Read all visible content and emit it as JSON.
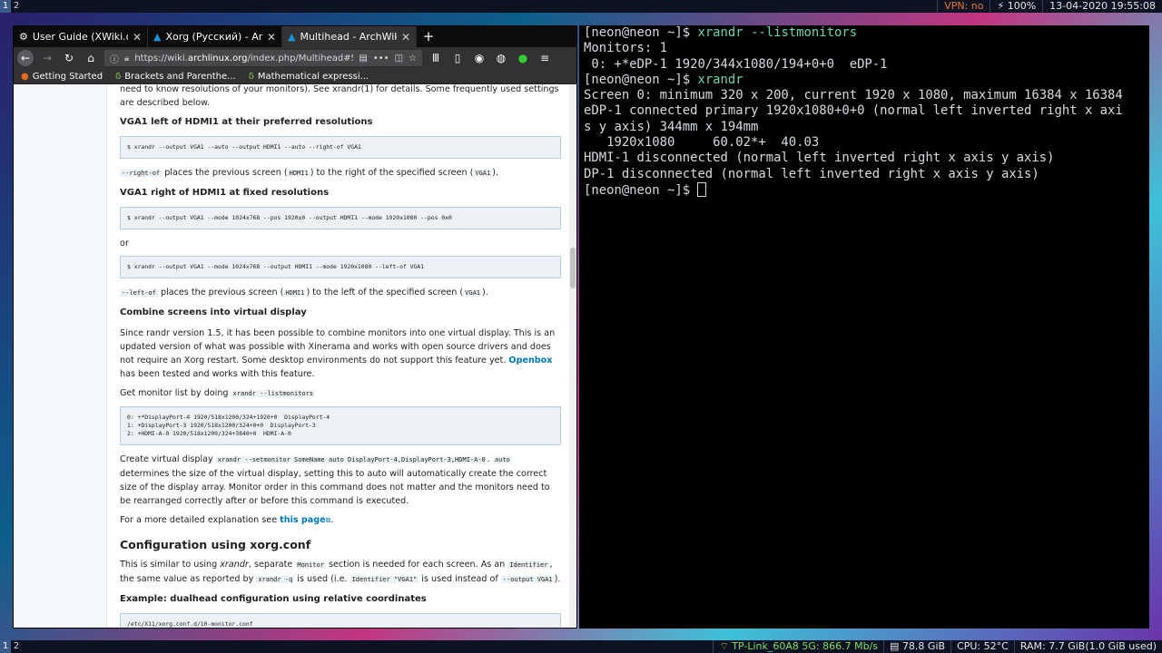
{
  "topbar": {
    "workspaces": [
      "1",
      "2"
    ],
    "vpn": "VPN: no",
    "battery": "100%",
    "battery_icon": "⚡",
    "datetime": "13-04-2020 19:55:08"
  },
  "bottombar": {
    "workspaces": [
      "1",
      "2"
    ],
    "wifi": "TP-Link_60A8 5G: 866.7 Mb/s",
    "disk": "78.8 GiB",
    "cpu": "CPU: 52°C",
    "ram": "RAM: 7.7 GiB(1.0 GiB used)"
  },
  "browser": {
    "tabs": [
      {
        "title": "User Guide (XWiki.org)",
        "icon": "gear-icon"
      },
      {
        "title": "Xorg (Русский) - ArchWiki",
        "icon": "arch-icon"
      },
      {
        "title": "Multihead - ArchWiki",
        "icon": "arch-icon"
      }
    ],
    "url_prefix": "https://wiki.",
    "url_domain": "archlinux.org",
    "url_suffix": "/index.php/Multihead#Sep",
    "bookmarks": [
      "Getting Started",
      "Brackets and Parenthe...",
      "Mathematical expressi..."
    ]
  },
  "wiki": {
    "intro": "need to know resolutions of your monitors). See xrandr(1) for details. Some frequently used settings are described below.",
    "h_vga_left": "VGA1 left of HDMI1 at their preferred resolutions",
    "pre1": "$ xrandr --output VGA1 --auto --output HDMI1 --auto --right-of VGA1",
    "p_rightof_code": "--right-of",
    "p_rightof_a": " places the previous screen (",
    "p_rightof_hdmi": "HDMI1",
    "p_rightof_b": ") to the right of the specified screen (",
    "p_rightof_vga": "VGA1",
    "p_rightof_c": ").",
    "h_vga_right": "VGA1 right of HDMI1 at fixed resolutions",
    "pre2": "$ xrandr --output VGA1 --mode 1024x768 --pos 1920x0 --output HDMI1 --mode 1920x1080 --pos 0x0",
    "or": "or",
    "pre3": "$ xrandr --output VGA1 --mode 1024x768 --output HDMI1 --mode 1920x1080 --left-of VGA1",
    "p_leftof_code": "--left-of",
    "p_leftof_a": " places the previous screen (",
    "p_leftof_hdmi": "HDMI1",
    "p_leftof_b": ") to the left of the specified screen (",
    "p_leftof_vga": "VGA1",
    "p_leftof_c": ").",
    "h_combine": "Combine screens into virtual display",
    "p_combine_a": "Since randr version 1.5, it has been possible to combine monitors into one virtual display. This is an updated version of what was possible with Xinerama and works with open source drivers and does not require an Xorg restart. Some desktop environments do not support this feature yet. ",
    "p_combine_link": "Openbox",
    "p_combine_b": " has been tested and works with this feature.",
    "p_getlist": "Get monitor list by doing ",
    "p_getlist_code": "xrandr --listmonitors",
    "pre4": "0: +*DisplayPort-4 1920/518x1200/324+1920+0  DisplayPort-4\n1: +DisplayPort-3 1920/518x1200/324+0+0  DisplayPort-3\n2: +HDMI-A-0 1920/518x1200/324+3840+0  HDMI-A-0",
    "p_create_a": "Create virtual display ",
    "p_create_code": "xrandr --setmonitor SomeName auto DisplayPort-4,DisplayPort-3,HDMI-A-0",
    "p_create_sep": ". ",
    "p_create_auto": "auto",
    "p_create_b": " determines the size of the virtual display, setting this to auto will automatically create the correct size of the display array. Monitor order in this command does not matter and the monitors need to be rearranged correctly after or before this command is executed.",
    "p_more_a": "For a more detailed explanation see ",
    "p_more_link": "this page",
    "p_more_b": ".",
    "h_config": "Configuration using xorg.conf",
    "p_similar_a": "This is similar to using ",
    "p_similar_em": "xrandr",
    "p_similar_b": ", separate ",
    "p_similar_monitor": "Monitor",
    "p_similar_c": " section is needed for each screen. As an ",
    "p_similar_ident": "Identifier",
    "p_similar_d": ", the same value as reported by ",
    "p_similar_q": "xrandr -q",
    "p_similar_e": " is used (i.e. ",
    "p_similar_idv": "Identifier \"VGA1\"",
    "p_similar_f": " is used instead of ",
    "p_similar_out": "--output VGA1",
    "p_similar_g": ").",
    "h_example": "Example: dualhead configuration using relative coordinates",
    "pre5": "/etc/X11/xorg.conf.d/10-monitor.conf"
  },
  "terminal": {
    "prompt": "[neon@neon ~]$ ",
    "lines": [
      {
        "prompt": "[neon@neon ~]$ ",
        "cmd": "xrandr --listmonitors"
      },
      {
        "text": "Monitors: 1"
      },
      {
        "text": " 0: +*eDP-1 1920/344x1080/194+0+0  eDP-1"
      },
      {
        "prompt": "[neon@neon ~]$ ",
        "cmd": "xrandr"
      },
      {
        "text": "Screen 0: minimum 320 x 200, current 1920 x 1080, maximum 16384 x 16384"
      },
      {
        "text": "eDP-1 connected primary 1920x1080+0+0 (normal left inverted right x axi"
      },
      {
        "text": "s y axis) 344mm x 194mm"
      },
      {
        "text": "   1920x1080     60.02*+  40.03"
      },
      {
        "text": "HDMI-1 disconnected (normal left inverted right x axis y axis)"
      },
      {
        "text": "DP-1 disconnected (normal left inverted right x axis y axis)"
      },
      {
        "prompt": "[neon@neon ~]$ ",
        "cmd": ""
      }
    ]
  }
}
